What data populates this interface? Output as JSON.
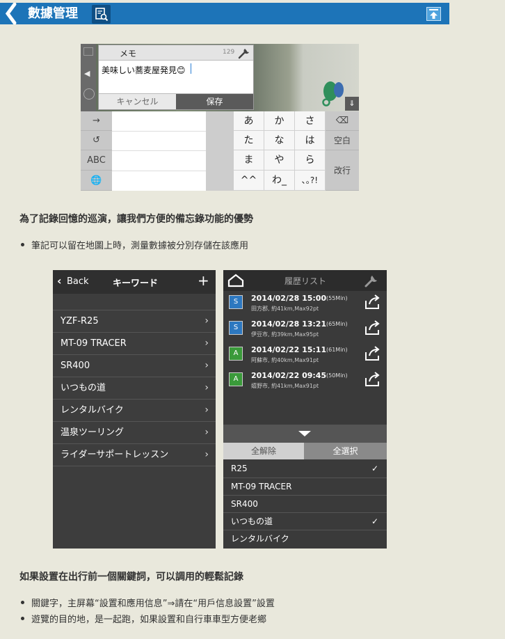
{
  "header": {
    "title": "數據管理",
    "back_icon": "chevron-left-icon",
    "page_icon": "search-document-icon",
    "top_icon": "back-to-top-icon",
    "colors": {
      "bar": "#1d74b8",
      "icon_bg": "#0f4f84"
    }
  },
  "screenshot1": {
    "memo": {
      "title": "メモ",
      "count": "129",
      "text": "美味しい蕎麦屋発見😊",
      "cancel": "キャンセル",
      "save": "保存"
    },
    "keyboard": {
      "side": [
        "→",
        "↺",
        "ABC",
        "🌐"
      ],
      "kana": [
        [
          "あ",
          "か",
          "さ"
        ],
        [
          "た",
          "な",
          "は"
        ],
        [
          "ま",
          "や",
          "ら"
        ],
        [
          "^^",
          "わ_",
          "､｡?!"
        ]
      ],
      "backspace": "⌫",
      "space": "空白",
      "enter": "改行"
    }
  },
  "section1": {
    "heading": "為了記錄回憶的巡演，讓我們方便的備忘錄功能的優勢",
    "bullets": [
      "筆記可以留在地圖上時，測量數據被分別存儲在該應用"
    ]
  },
  "keyword_screen": {
    "back": "Back",
    "title": "キーワード",
    "add": "+",
    "items": [
      "YZF-R25",
      "MT-09 TRACER",
      "SR400",
      "いつもの道",
      "レンタルバイク",
      "温泉ツーリング",
      "ライダーサポートレッスン"
    ]
  },
  "history_screen": {
    "title": "履歴リスト",
    "entries": [
      {
        "badge": "S",
        "date": "2014/02/28 15:00",
        "duration": "(55Min)",
        "sub": "田方郡, 約41km,Max92pt",
        "color": "#2d78c0"
      },
      {
        "badge": "S",
        "date": "2014/02/28 13:21",
        "duration": "(65Min)",
        "sub": "伊豆市, 約39km,Max95pt",
        "color": "#2d78c0"
      },
      {
        "badge": "A",
        "date": "2014/02/22 15:11",
        "duration": "(61Min)",
        "sub": "阿蘇市, 約40km,Max91pt",
        "color": "#3a9a3a"
      },
      {
        "badge": "A",
        "date": "2014/02/22 09:45",
        "duration": "(50Min)",
        "sub": "嬉野市, 約41km,Max91pt",
        "color": "#3a9a3a"
      }
    ],
    "clear_all": "全解除",
    "select_all": "全選択",
    "filters": [
      {
        "label": "R25",
        "checked": "✓"
      },
      {
        "label": "MT-09 TRACER",
        "checked": ""
      },
      {
        "label": "SR400",
        "checked": ""
      },
      {
        "label": "いつもの道",
        "checked": "✓"
      },
      {
        "label": "レンタルバイク",
        "checked": ""
      }
    ]
  },
  "section2": {
    "heading": "如果設置在出行前一個關鍵詞，可以調用的輕鬆記錄",
    "bullets": [
      "關鍵字，主屏幕“設置和應用信息”⇒請在“用戶信息設置”設置",
      "遊覽的目的地，是一起跑，如果設置和自行車車型方便老鄉"
    ]
  }
}
